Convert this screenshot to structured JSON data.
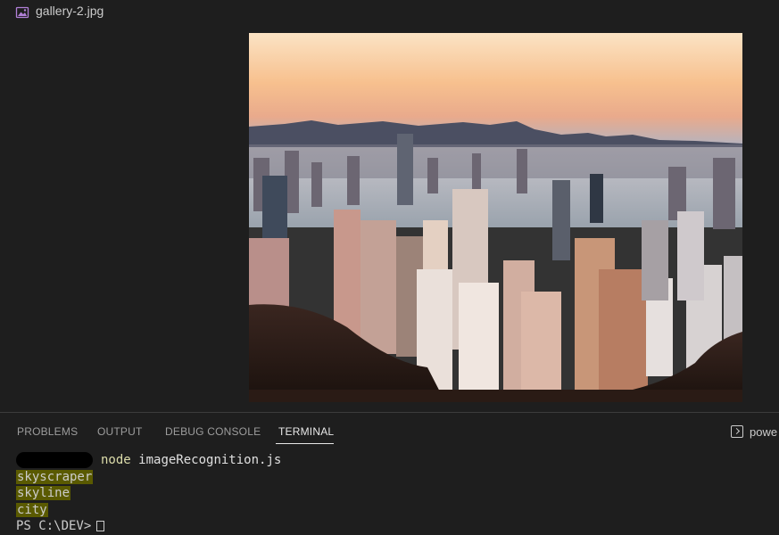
{
  "editor": {
    "file_name": "gallery-2.jpg",
    "file_icon": "image-file-icon"
  },
  "panel": {
    "tabs": [
      {
        "label": "PROBLEMS"
      },
      {
        "label": "OUTPUT"
      },
      {
        "label": "DEBUG CONSOLE"
      },
      {
        "label": "TERMINAL",
        "active": true
      }
    ],
    "shell_label": "powe",
    "shell_icon": "terminal-shell-icon"
  },
  "terminal": {
    "command_keyword": "node",
    "command_argument": "imageRecognition.js",
    "output": [
      "skyscraper",
      "skyline",
      "city"
    ],
    "prompt_fragment": "PS C:\\DEV>"
  },
  "colors": {
    "background": "#1e1e1e",
    "highlight": "#5a5a00",
    "command": "#dcdcaa"
  }
}
